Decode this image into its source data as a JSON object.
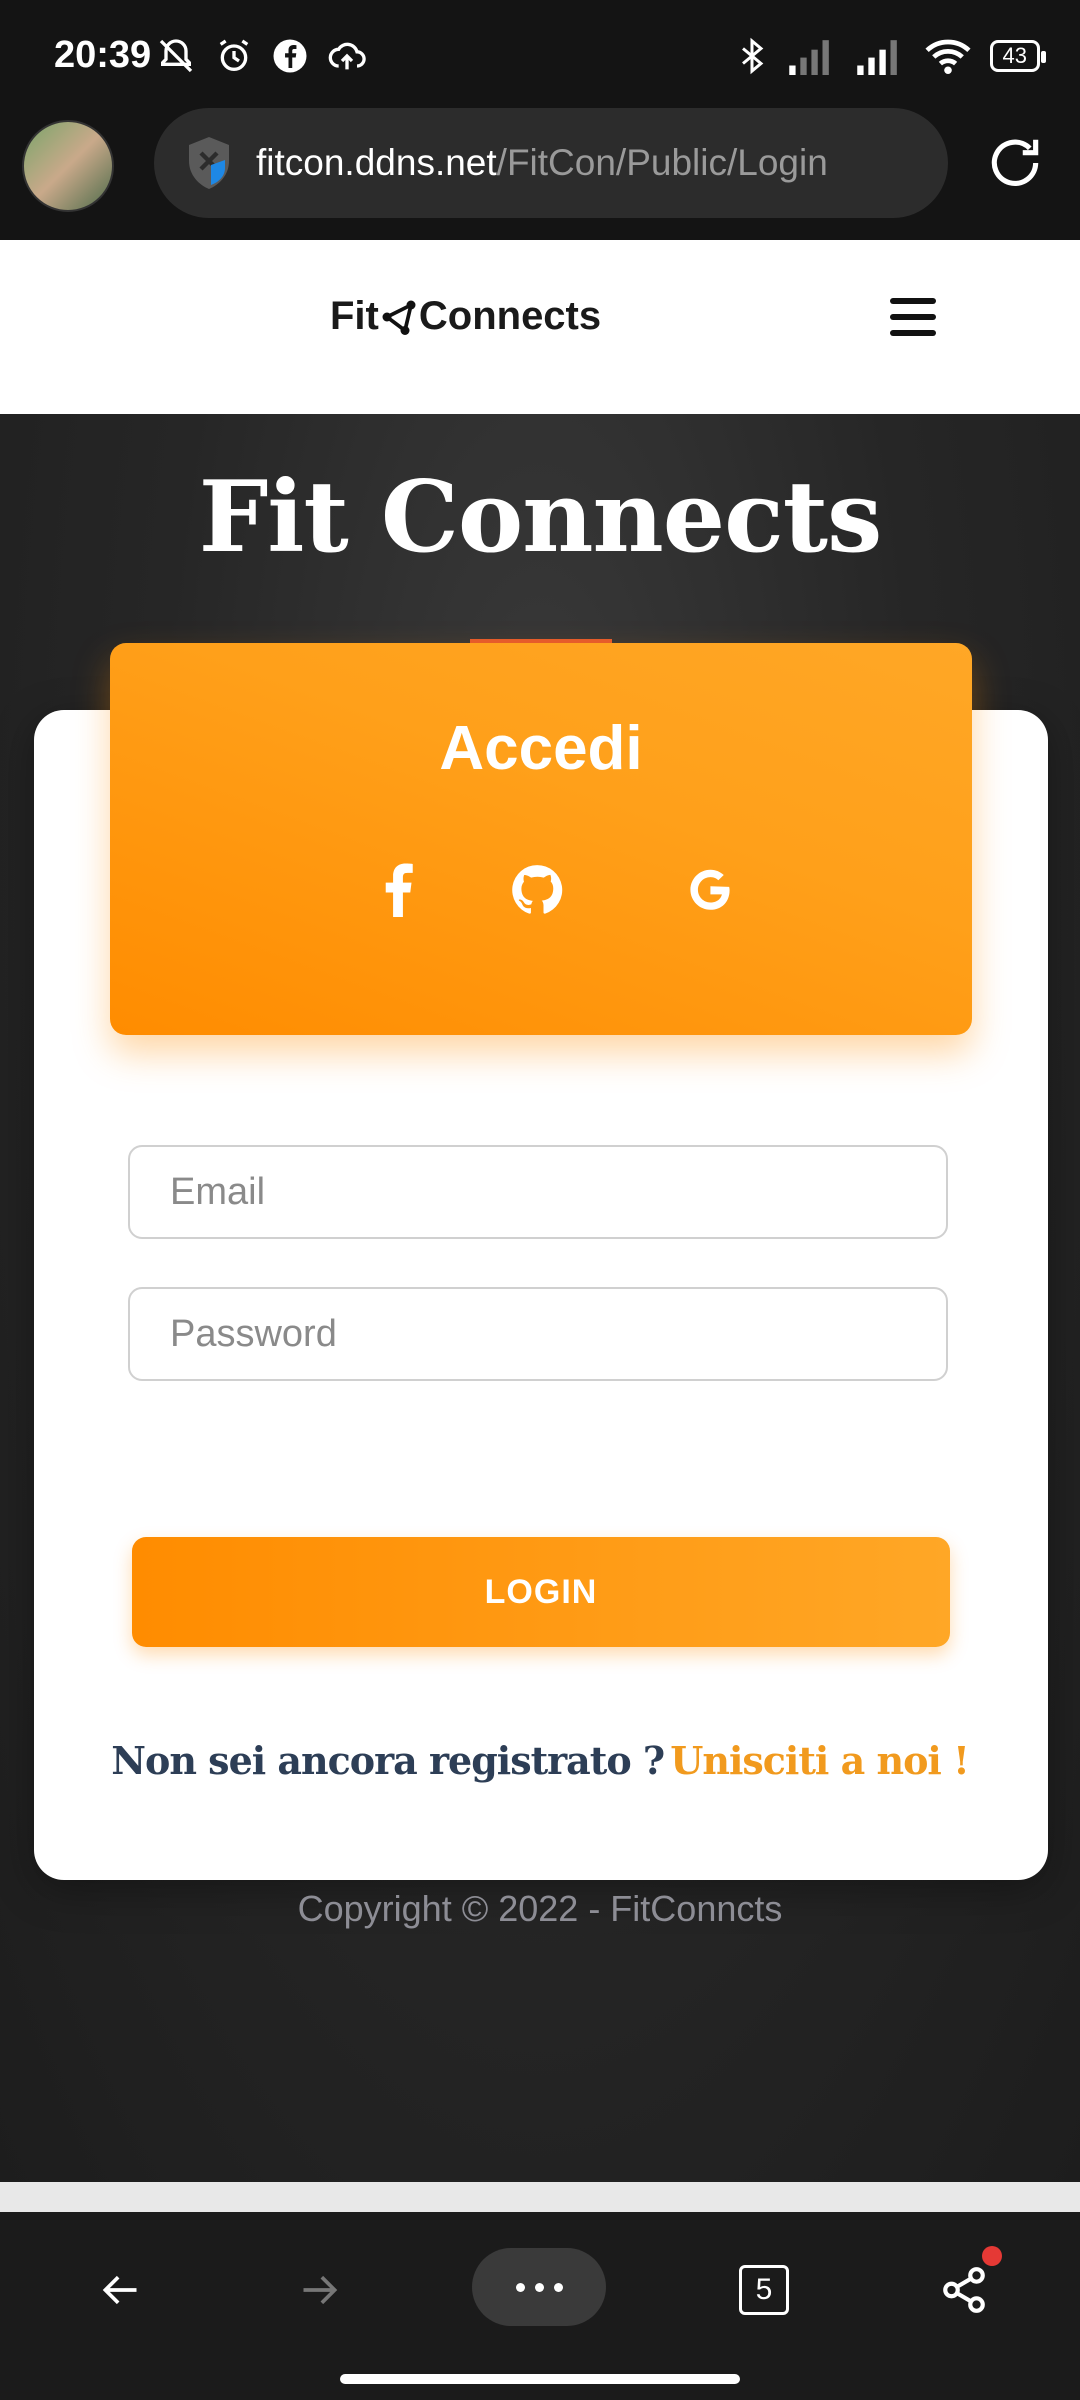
{
  "status_bar": {
    "time": "20:39",
    "left_icons": [
      "mute-icon",
      "alarm-icon",
      "facebook-icon",
      "cloud-upload-icon"
    ],
    "right_icons": [
      "bluetooth-icon",
      "signal-icon",
      "signal-icon",
      "wifi-icon"
    ],
    "battery": "43"
  },
  "browser": {
    "url_domain": "fitcon.ddns.net",
    "url_path": "/FitCon/Public/Login"
  },
  "site_nav": {
    "brand_left": "Fit",
    "brand_right": "Connects"
  },
  "hero": {
    "title": "Fit Connects"
  },
  "login_card": {
    "title": "Accedi",
    "social_icons": [
      "facebook-icon",
      "github-icon",
      "google-icon"
    ],
    "email_placeholder": "Email",
    "password_placeholder": "Password",
    "login_label": "LOGIN",
    "register_question": "Non sei ancora registrato ?",
    "register_link": "Unisciti a noi !"
  },
  "footer": {
    "copyright": "Copyright © 2022 - FitConncts"
  },
  "bottom_nav": {
    "tabs_count": "5"
  },
  "colors": {
    "accent": "#ff8c00",
    "accent_light": "#ffa726",
    "register_text": "#2d3e56",
    "register_link": "#f19a1e"
  }
}
